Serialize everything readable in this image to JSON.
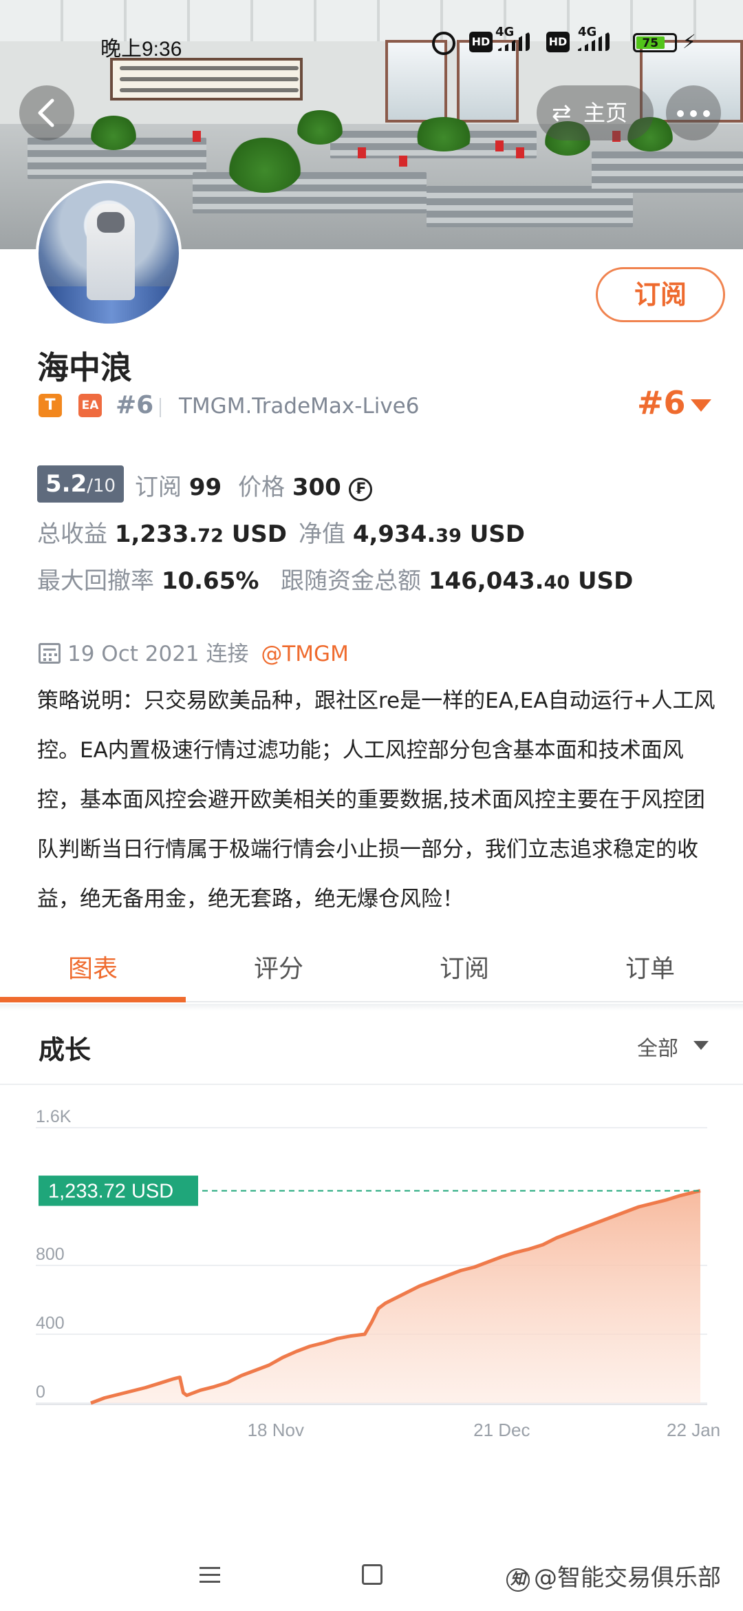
{
  "status_bar": {
    "time": "晚上9:36",
    "network1": "4G",
    "network2": "4G",
    "battery": "75"
  },
  "header": {
    "home_label": "主页",
    "home_icon": "swap-icon"
  },
  "profile": {
    "name": "海中浪",
    "badge_t": "T",
    "badge_ea": "EA",
    "rank_small": "#6",
    "server": "TMGM.TradeMax-Live6",
    "rank_big": "#6",
    "subscribe_label": "订阅"
  },
  "stats": {
    "rating_value": "5.2",
    "rating_den": "/10",
    "subs_label": "订阅",
    "subs_value": "99",
    "price_label": "价格",
    "price_value": "300",
    "price_icon": "₣",
    "profit_label": "总收益",
    "profit_int": "1,233.",
    "profit_dec": "72",
    "profit_unit": "USD",
    "equity_label": "净值",
    "equity_int": "4,934.",
    "equity_dec": "39",
    "equity_unit": "USD",
    "drawdown_label": "最大回撤率",
    "drawdown_value": "10.65%",
    "follow_label": "跟随资金总额",
    "follow_int": "146,043.",
    "follow_dec": "40",
    "follow_unit": "USD"
  },
  "connection": {
    "date": "19 Oct 2021",
    "label": "连接",
    "broker": "@TMGM"
  },
  "description": "策略说明：只交易欧美品种，跟社区re是一样的EA,EA自动运行+人工风控。EA内置极速行情过滤功能；人工风控部分包含基本面和技术面风控，基本面风控会避开欧美相关的重要数据,技术面风控主要在于风控团队判断当日行情属于极端行情会小止损一部分，我们立志追求稳定的收益，绝无备用金，绝无套路，绝无爆仓风险！",
  "tabs": [
    "图表",
    "评分",
    "订阅",
    "订单"
  ],
  "section": {
    "title": "成长",
    "filter": "全部"
  },
  "colors": {
    "accent": "#ef6b2e",
    "line": "#ef7a4a",
    "area_top": "#f7b79a",
    "marker": "#1fa67a",
    "rating_bg": "#5f6b7d"
  },
  "chart_data": {
    "type": "area",
    "title": "成长",
    "xlabel": "",
    "ylabel": "",
    "ylim": [
      0,
      1600
    ],
    "yticks": [
      0,
      400,
      800,
      1600
    ],
    "ytick_labels": [
      "0",
      "400",
      "800",
      "1.6K"
    ],
    "xticks": [
      "18 Nov",
      "21 Dec",
      "22 Jan"
    ],
    "xtick_pos": [
      27,
      60,
      88
    ],
    "current_label": "1,233.72 USD",
    "current_value": 1233.72,
    "series": [
      {
        "x": [
          0,
          2,
          4,
          6,
          8,
          10,
          12,
          13,
          13.5,
          14,
          16,
          18,
          20,
          22,
          24,
          26,
          28,
          30,
          32,
          34,
          36,
          38,
          40,
          41,
          42,
          43,
          44,
          46,
          48,
          50,
          52,
          54,
          56,
          58,
          60,
          62,
          64,
          66,
          68,
          70,
          72,
          74,
          76,
          78,
          80,
          82,
          84,
          86,
          88,
          89
        ],
        "values": [
          0,
          30,
          50,
          70,
          90,
          115,
          140,
          150,
          60,
          45,
          75,
          95,
          120,
          160,
          190,
          220,
          265,
          300,
          330,
          350,
          375,
          390,
          400,
          470,
          550,
          580,
          600,
          640,
          680,
          710,
          740,
          770,
          790,
          820,
          850,
          875,
          895,
          920,
          960,
          990,
          1020,
          1050,
          1080,
          1110,
          1140,
          1160,
          1180,
          1205,
          1225,
          1233.72
        ]
      }
    ]
  },
  "navbar": {
    "watermark_icon": "知",
    "watermark": "@智能交易俱乐部"
  }
}
